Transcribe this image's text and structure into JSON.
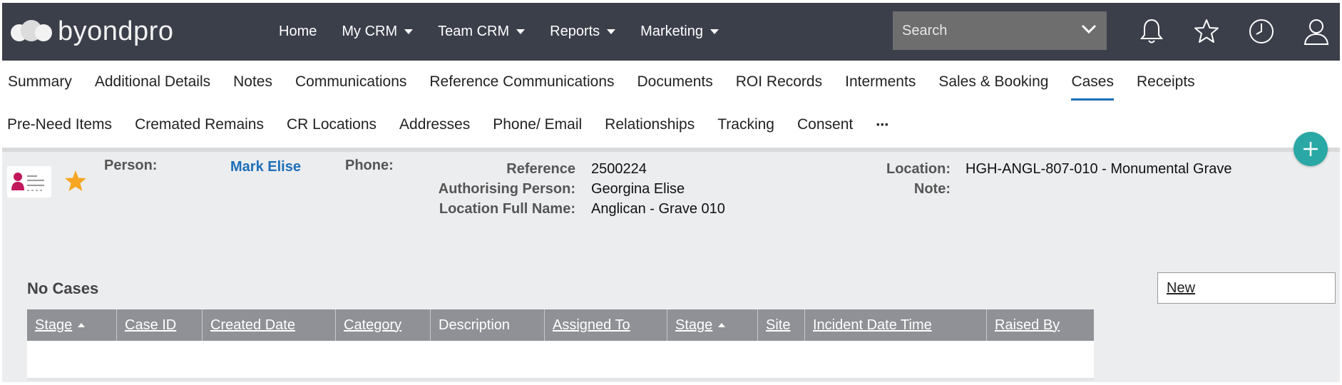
{
  "app": {
    "logo_text": "byondpro"
  },
  "nav": {
    "items": [
      {
        "label": "Home",
        "dropdown": false
      },
      {
        "label": "My CRM",
        "dropdown": true
      },
      {
        "label": "Team CRM",
        "dropdown": true
      },
      {
        "label": "Reports",
        "dropdown": true
      },
      {
        "label": "Marketing",
        "dropdown": true
      }
    ]
  },
  "search": {
    "placeholder": "Search",
    "value": ""
  },
  "header_icons": [
    "bell-icon",
    "star-icon",
    "clock-icon",
    "user-icon"
  ],
  "tabs": {
    "row1": [
      "Summary",
      "Additional Details",
      "Notes",
      "Communications",
      "Reference Communications",
      "Documents",
      "ROI Records",
      "Interments",
      "Sales & Booking",
      "Cases",
      "Receipts"
    ],
    "row2": [
      "Pre-Need Items",
      "Cremated Remains",
      "CR Locations",
      "Addresses",
      "Phone/ Email",
      "Relationships",
      "Tracking",
      "Consent"
    ],
    "more": "⋯",
    "active": "Cases"
  },
  "record": {
    "person_label": "Person:",
    "person_value": "Mark Elise",
    "phone_label": "Phone:",
    "reference_label": "Reference",
    "reference_value": "2500224",
    "authorising_label": "Authorising Person:",
    "authorising_value": "Georgina Elise",
    "location_full_label": "Location Full Name:",
    "location_full_value": "Anglican - Grave 010",
    "location_label": "Location:",
    "location_value": "HGH-ANGL-807-010 - Monumental Grave",
    "note_label": "Note:"
  },
  "cases": {
    "title": "No Cases",
    "new_button": "New",
    "columns": [
      {
        "label": "Stage",
        "link": true,
        "sort": "asc"
      },
      {
        "label": "Case ID",
        "link": true
      },
      {
        "label": "Created Date",
        "link": true
      },
      {
        "label": "Category",
        "link": true
      },
      {
        "label": "Description",
        "link": false
      },
      {
        "label": "Assigned To",
        "link": true
      },
      {
        "label": "Stage",
        "link": true,
        "sort": "asc"
      },
      {
        "label": "Site",
        "link": true
      },
      {
        "label": "Incident Date Time",
        "link": true
      },
      {
        "label": "Raised By",
        "link": true
      }
    ],
    "rows": []
  },
  "colors": {
    "topbar": "#3b3f4a",
    "accent": "#1d6fb8",
    "fab": "#29a8a6",
    "star": "#f5a623",
    "grid_header": "#8f9196"
  }
}
